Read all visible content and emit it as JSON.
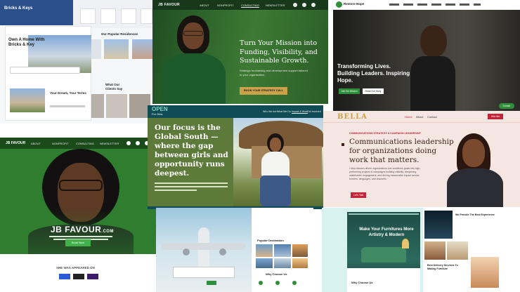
{
  "tile_a": {
    "brand": "Bricks & Keys",
    "hero_title": "Own A Home With Bricks & Key",
    "section_title": "Our Popular Residences",
    "clients_title": "What Our Clients Say",
    "dream_title": "Your Dream, Your Terms"
  },
  "tile_b": {
    "logo": "JB FAVOUR",
    "nav": [
      "ABOUT",
      "NONPROFIT",
      "CONSULTING",
      "NEWSLETTER"
    ],
    "headline": "Turn Your Mission into Funding, Visibility, and Sustainable Growth.",
    "subtext": "Strategic fundraising and development support tailored to your organization.",
    "cta": "BOOK YOUR STRATEGY CALL"
  },
  "tile_c": {
    "brand": "Restore Hope",
    "headline": "Transforming Lives. Building Leaders. Inspiring Hope.",
    "btn_join": "Join the Mission",
    "btn_story": "Read Our Story",
    "donate": "Donate"
  },
  "tile_d": {
    "logo": "JB FAVOUR",
    "nav": [
      "ABOUT",
      "NONPROFIT",
      "CONSULTING",
      "NEWSLETTER"
    ],
    "title": "JB FAVOUR",
    "title_suffix": ".COM",
    "cta": "Book Now",
    "featured": "SHE WAS APPEARED ON"
  },
  "tile_e": {
    "logo_main": "OPEN",
    "logo_sub": "For Girls",
    "nav": [
      "Who We Are",
      "What We Do",
      "Impact & Work",
      "Get Involved"
    ],
    "headline": "Our focus is the Global South — where the gap between girls and opportunity runs deepest."
  },
  "tile_f": {
    "logo": "BELLA",
    "nav": [
      "Home",
      "About",
      "Contact"
    ],
    "nav_cta": "Hire Me",
    "eyebrow": "COMMUNICATIONS STRATEGY & CAMPAIGN LEADERSHIP",
    "headline": "Communications leadership for organizations doing work that matters.",
    "body": "I help mission-driven organizations turn ambitious goals into high-performing projects & campaigns building visibility, deepening stakeholder engagement, and driving measurable impact across borders, languages, and channels.",
    "cta": "Let's Talk"
  },
  "tile_g": {
    "section": "Popular Destination",
    "why": "Why Choose Us"
  },
  "tile_h": {
    "headline": "Make Your Furnitures More Artistry & Modern",
    "why": "Why Choose Us",
    "side_title": "We Provide The Best Experience",
    "side_sub": "Best Delivery Services To Making Furniture"
  },
  "colors": {
    "forest": "#3a5a2c",
    "olive": "#5e7a3b",
    "gold": "#c9a24a",
    "blush": "#f5e6e2",
    "crimson": "#c0263a",
    "bright_green": "#2f8f3a"
  }
}
